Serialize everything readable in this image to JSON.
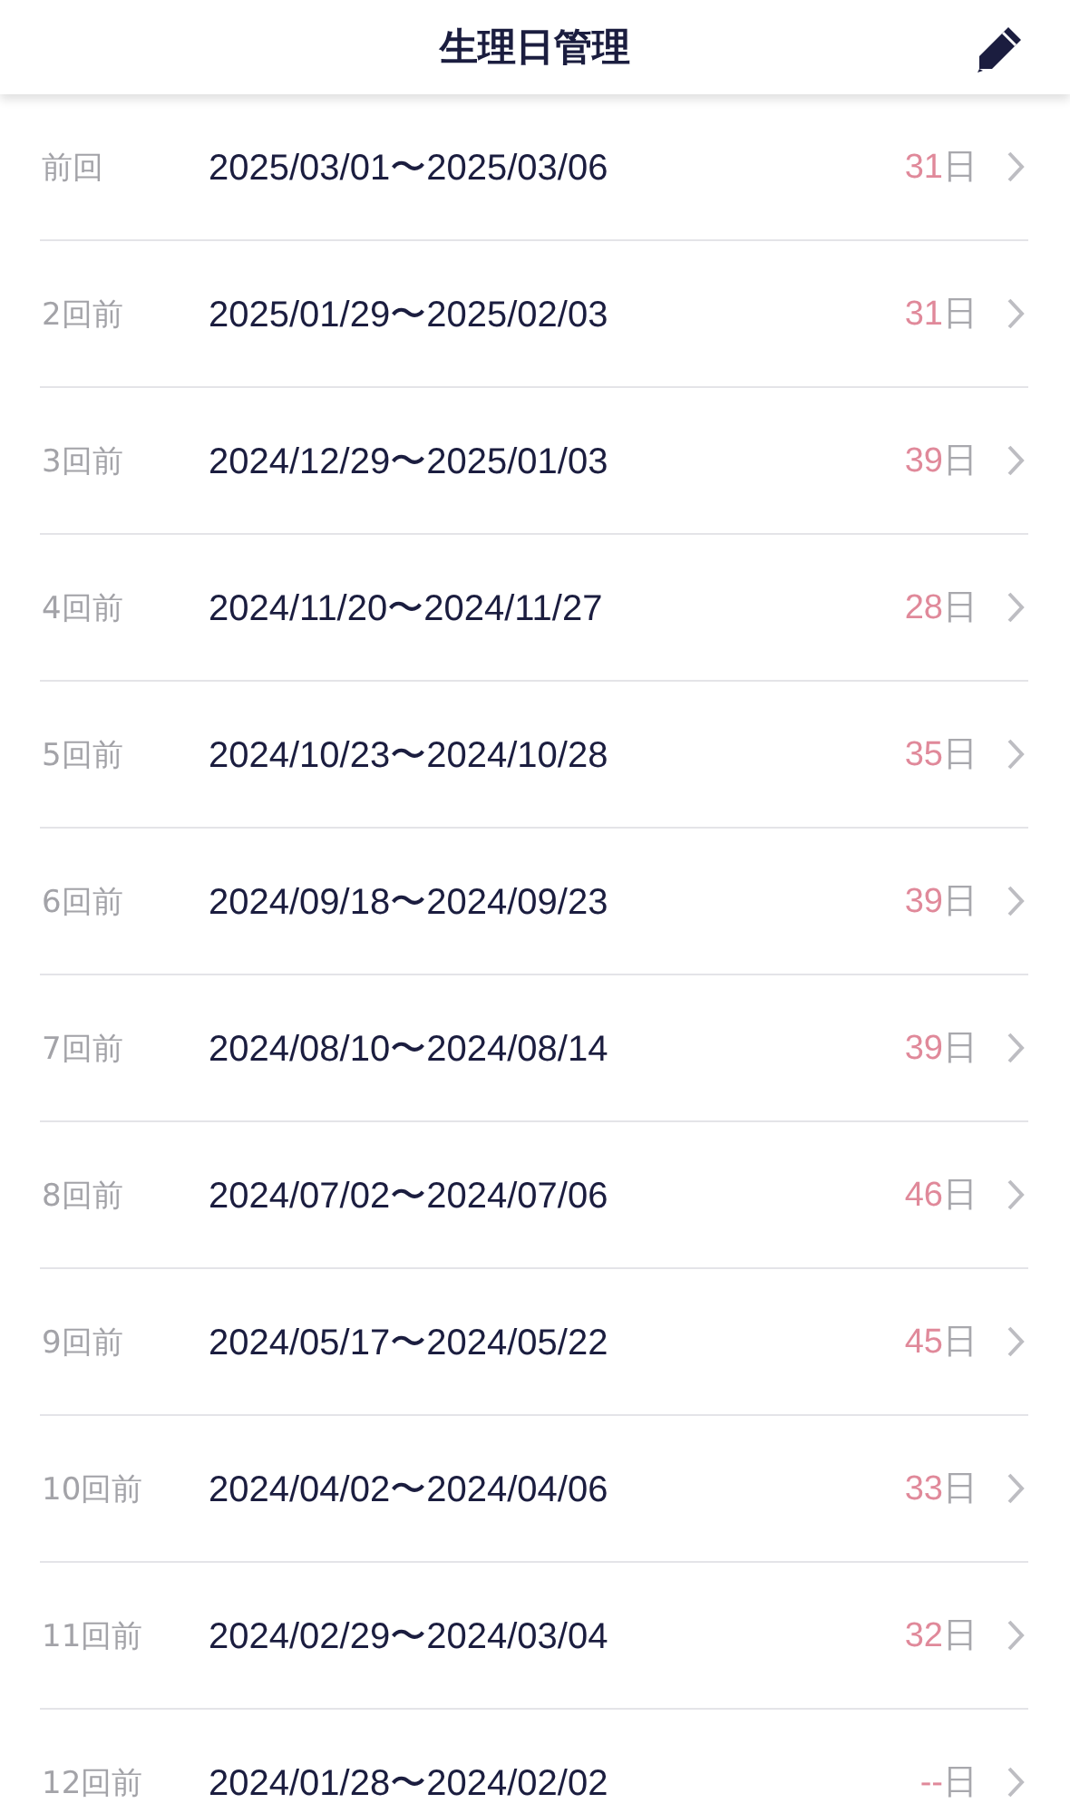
{
  "header": {
    "title": "生理日管理"
  },
  "periods": [
    {
      "label": "前回",
      "range": "2025/03/01〜2025/03/06",
      "cycle": "31",
      "unit": "日"
    },
    {
      "label": "2回前",
      "range": "2025/01/29〜2025/02/03",
      "cycle": "31",
      "unit": "日"
    },
    {
      "label": "3回前",
      "range": "2024/12/29〜2025/01/03",
      "cycle": "39",
      "unit": "日"
    },
    {
      "label": "4回前",
      "range": "2024/11/20〜2024/11/27",
      "cycle": "28",
      "unit": "日"
    },
    {
      "label": "5回前",
      "range": "2024/10/23〜2024/10/28",
      "cycle": "35",
      "unit": "日"
    },
    {
      "label": "6回前",
      "range": "2024/09/18〜2024/09/23",
      "cycle": "39",
      "unit": "日"
    },
    {
      "label": "7回前",
      "range": "2024/08/10〜2024/08/14",
      "cycle": "39",
      "unit": "日"
    },
    {
      "label": "8回前",
      "range": "2024/07/02〜2024/07/06",
      "cycle": "46",
      "unit": "日"
    },
    {
      "label": "9回前",
      "range": "2024/05/17〜2024/05/22",
      "cycle": "45",
      "unit": "日"
    },
    {
      "label": "10回前",
      "range": "2024/04/02〜2024/04/06",
      "cycle": "33",
      "unit": "日"
    },
    {
      "label": "11回前",
      "range": "2024/02/29〜2024/03/04",
      "cycle": "32",
      "unit": "日"
    },
    {
      "label": "12回前",
      "range": "2024/01/28〜2024/02/02",
      "cycle": "--",
      "unit": "日"
    }
  ]
}
